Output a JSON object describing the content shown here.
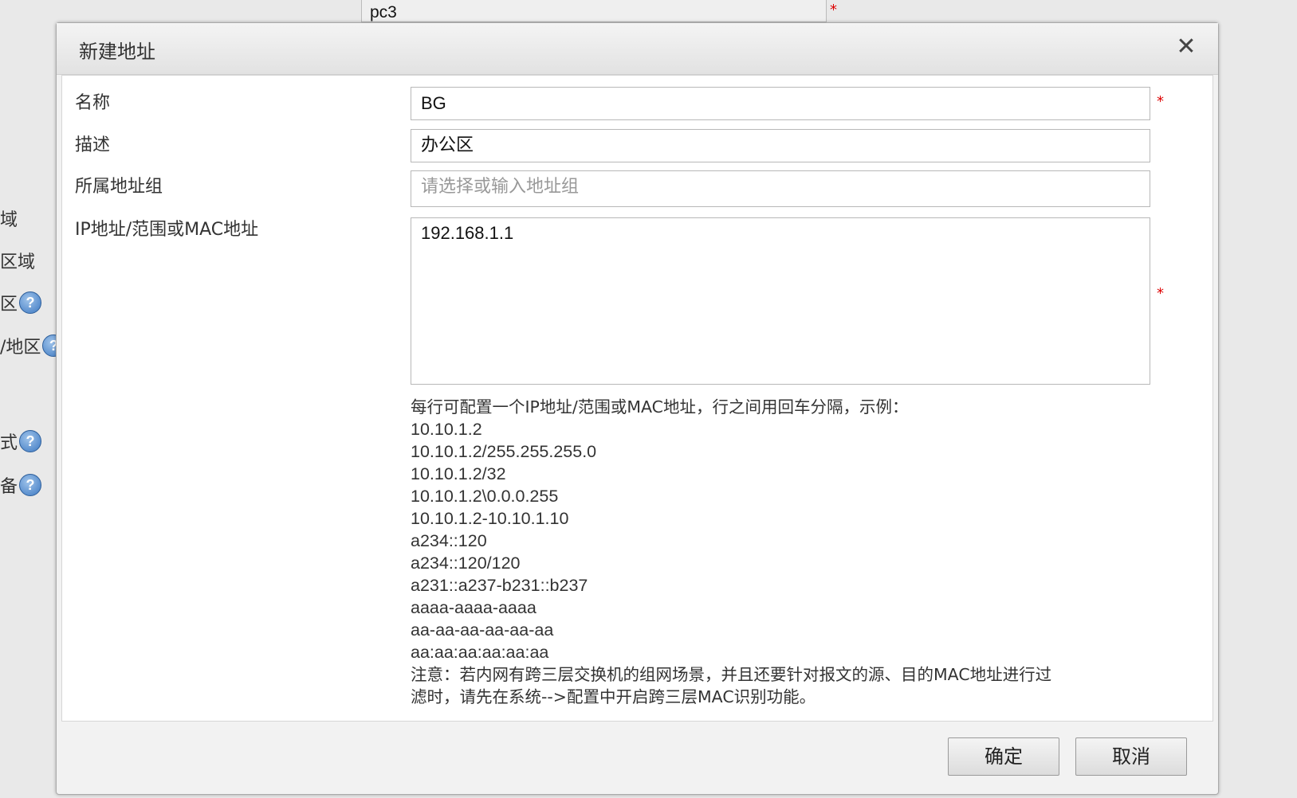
{
  "background": {
    "table_cell": "pc3",
    "required_marker": "*",
    "left_labels": [
      {
        "text": "域",
        "help": false
      },
      {
        "text": "区域",
        "help": false
      },
      {
        "text": "区",
        "help": true
      },
      {
        "text": "/地区",
        "help": true
      },
      {
        "text": "式",
        "help": true
      },
      {
        "text": "备",
        "help": true
      }
    ],
    "help_glyph": "?"
  },
  "dialog": {
    "title": "新建地址",
    "close_glyph": "✕",
    "fields": {
      "name_label": "名称",
      "name_value": "BG",
      "desc_label": "描述",
      "desc_value": "办公区",
      "group_label": "所属地址组",
      "group_placeholder": "请选择或输入地址组",
      "address_label": "IP地址/范围或MAC地址",
      "address_value": "192.168.1.1"
    },
    "required_marker": "*",
    "help": {
      "intro": "每行可配置一个IP地址/范围或MAC地址，行之间用回车分隔，示例：",
      "examples": [
        "10.10.1.2",
        "10.10.1.2/255.255.255.0",
        "10.10.1.2/32",
        "10.10.1.2\\0.0.0.255",
        "10.10.1.2-10.10.1.10",
        "a234::120",
        "a234::120/120",
        "a231::a237-b231::b237",
        "aaaa-aaaa-aaaa",
        "aa-aa-aa-aa-aa-aa",
        "aa:aa:aa:aa:aa:aa"
      ],
      "note_line1": "注意：若内网有跨三层交换机的组网场景，并且还要针对报文的源、目的MAC地址进行过",
      "note_line2": "滤时，请先在系统-->配置中开启跨三层MAC识别功能。"
    },
    "buttons": {
      "confirm": "确定",
      "cancel": "取消"
    }
  }
}
